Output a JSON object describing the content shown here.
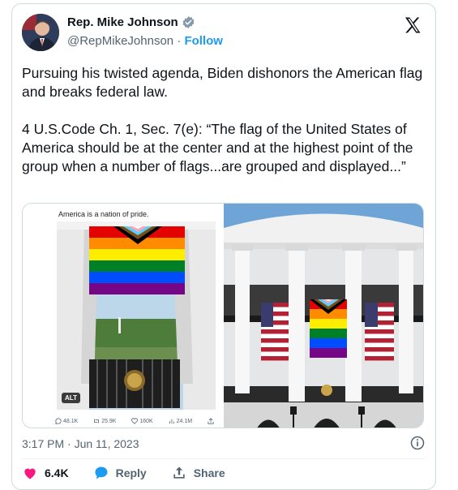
{
  "author": {
    "name": "Rep. Mike Johnson",
    "handle": "@RepMikeJohnson",
    "separator": "·",
    "follow_label": "Follow"
  },
  "tweet": {
    "text": "Pursuing his twisted agenda, Biden dishonors the American flag and breaks federal law.\n\n4 U.S.Code Ch. 1, Sec. 7(e): “The flag of the United States of America should be at the center and at the highest point of the group when a number of flags...are grouped and displayed...”",
    "timestamp": "3:17 PM · Jun 11, 2023"
  },
  "embedded_image": {
    "caption": "America is a nation of pride.",
    "alt_label": "ALT",
    "metrics": {
      "replies": "48.1K",
      "retweets": "25.9K",
      "likes": "160K",
      "views": "24.1M"
    }
  },
  "actions": {
    "likes": "6.4K",
    "reply_label": "Reply",
    "share_label": "Share"
  },
  "colors": {
    "accent": "#1d9bf0",
    "like": "#f91880",
    "verified": "#829aab"
  }
}
